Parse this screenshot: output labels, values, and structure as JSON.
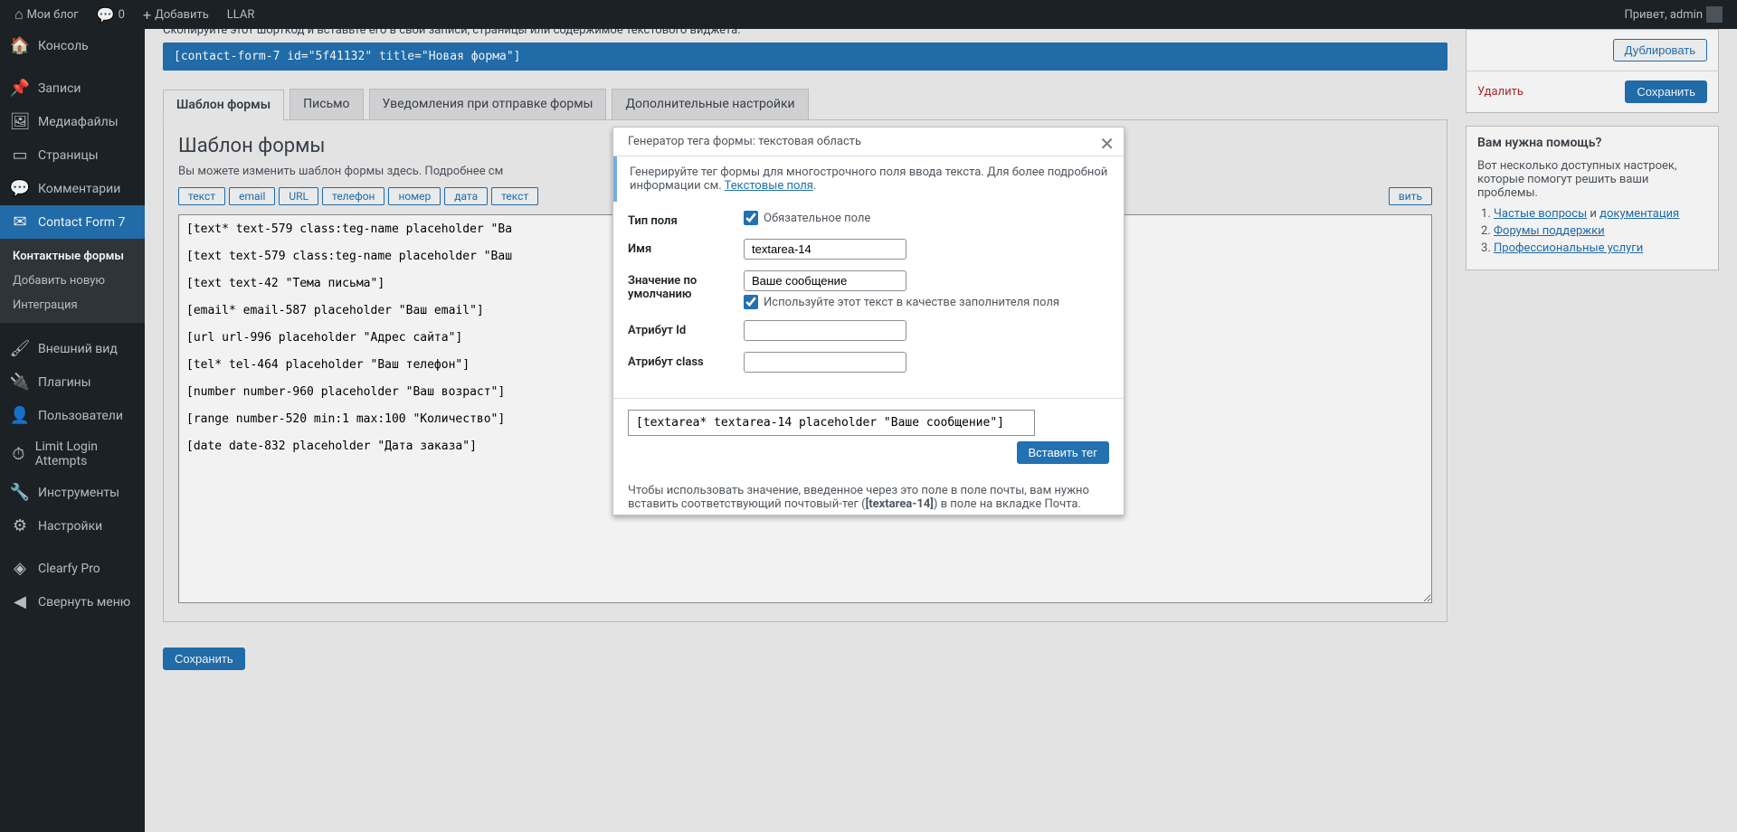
{
  "topbar": {
    "site": "Мои блог",
    "comments": "0",
    "add": "Добавить",
    "llar": "LLAR",
    "greeting": "Привет, admin"
  },
  "sidebar": {
    "items": [
      {
        "label": "Консоль"
      },
      {
        "label": "Записи"
      },
      {
        "label": "Медиафайлы"
      },
      {
        "label": "Страницы"
      },
      {
        "label": "Комментарии"
      },
      {
        "label": "Contact Form 7"
      },
      {
        "label": "Внешний вид"
      },
      {
        "label": "Плагины"
      },
      {
        "label": "Пользователи"
      },
      {
        "label": "Limit Login Attempts"
      },
      {
        "label": "Инструменты"
      },
      {
        "label": "Настройки"
      },
      {
        "label": "Clearfy Pro"
      },
      {
        "label": "Свернуть меню"
      }
    ],
    "submenu": [
      {
        "label": "Контактные формы"
      },
      {
        "label": "Добавить новую"
      },
      {
        "label": "Интеграция"
      }
    ]
  },
  "shortcode": {
    "hint": "Скопируйте этот шорткод и вставьте его в свои записи, страницы или содержимое текстового виджета:",
    "code": "[contact-form-7 id=\"5f41132\" title=\"Новая форма\"]"
  },
  "sidepanel": {
    "duplicate": "Дублировать",
    "delete": "Удалить",
    "save": "Сохранить",
    "help_title": "Вам нужна помощь?",
    "help_text": "Вот несколько доступных настроек, которые помогут решить ваши проблемы.",
    "links": {
      "faq": "Частые вопросы",
      "and": " и ",
      "docs": "документация",
      "forums": "Форумы поддержки",
      "pro": "Профессиональные услуги"
    }
  },
  "tabs": [
    {
      "label": "Шаблон формы"
    },
    {
      "label": "Письмо"
    },
    {
      "label": "Уведомления при отправке формы"
    },
    {
      "label": "Дополнительные настройки"
    }
  ],
  "panel": {
    "title": "Шаблон формы",
    "desc": "Вы можете изменить шаблон формы здесь. Подробнее см",
    "tag_buttons": [
      "текст",
      "email",
      "URL",
      "телефон",
      "номер",
      "дата",
      "текст",
      "",
      "",
      "",
      "",
      "",
      "",
      "",
      "вить"
    ],
    "textarea": "[text* text-579 class:teg-name placeholder \"Ва\n\n[text text-579 class:teg-name placeholder \"Ваш\n\n[text text-42 \"Тема письма\"]\n\n[email* email-587 placeholder \"Ваш email\"]\n\n[url url-996 placeholder \"Адрес сайта\"]\n\n[tel* tel-464 placeholder \"Ваш телефон\"]\n\n[number number-960 placeholder \"Ваш возраст\"]\n\n[range number-520 min:1 max:100 \"Количество\"]\n\n[date date-832 placeholder \"Дата заказа\"]",
    "save": "Сохранить"
  },
  "modal": {
    "title": "Генератор тега формы: текстовая область",
    "info_pre": "Генерируйте тег формы для многострочного поля ввода текста. Для более подробной информации см. ",
    "info_link": "Текстовые поля",
    "labels": {
      "type": "Тип поля",
      "required": "Обязательное поле",
      "name": "Имя",
      "default": "Значение по умолчанию",
      "placeholder_check": "Используйте этот текст в качестве заполнителя поля",
      "id": "Атрибут Id",
      "class": "Атрибут class"
    },
    "values": {
      "name": "textarea-14",
      "default": "Ваше сообщение",
      "id": "",
      "class": ""
    },
    "output": "[textarea* textarea-14 placeholder \"Ваше сообщение\"]",
    "insert": "Вставить тег",
    "hint_pre": "Чтобы использовать значение, введенное через это поле в поле почты, вам нужно вставить соответствующий почтовый-тег (",
    "hint_tag": "[textarea-14]",
    "hint_post": ") в поле на вкладке Почта."
  }
}
